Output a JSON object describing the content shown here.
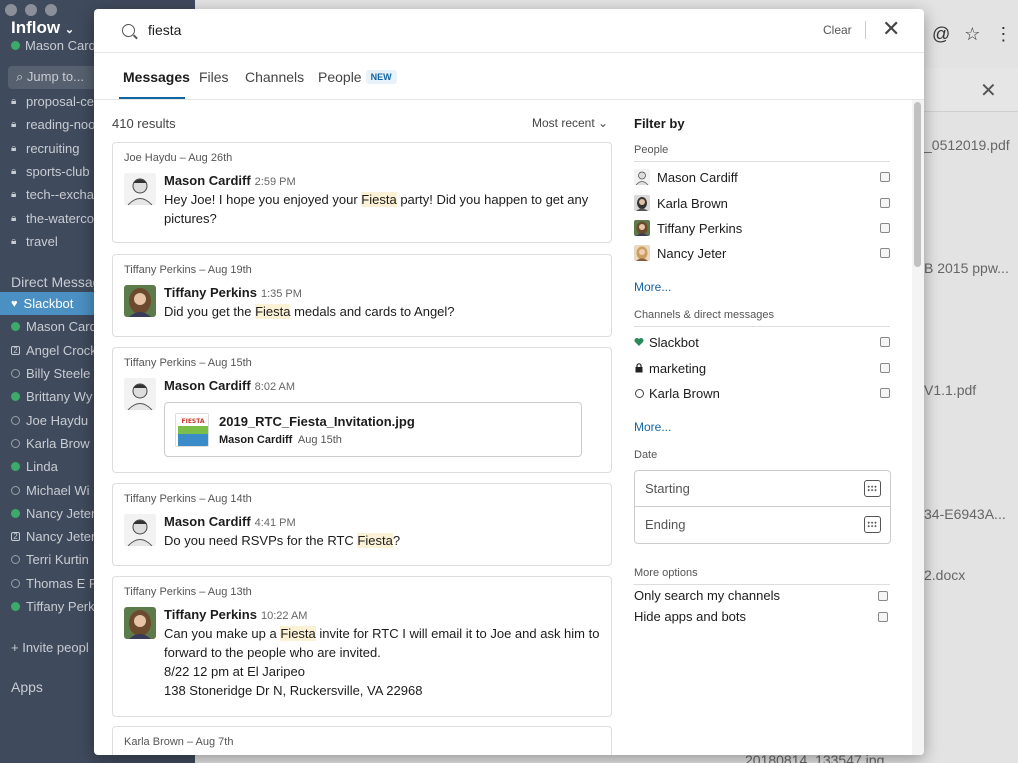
{
  "app": {
    "workspace": "Inflow",
    "user": "Mason Card",
    "jump_to": "Jump to...",
    "channels": [
      {
        "name": "proposal-ce"
      },
      {
        "name": "reading-noo"
      },
      {
        "name": "recruiting"
      },
      {
        "name": "sports-club"
      },
      {
        "name": "tech--excha"
      },
      {
        "name": "the-waterco"
      },
      {
        "name": "travel"
      }
    ],
    "direct_messages_header": "Direct Messag",
    "direct_messages": [
      {
        "name": "Slackbot",
        "status": "slackbot",
        "active": true
      },
      {
        "name": "Mason Card",
        "status": "online"
      },
      {
        "name": "Angel Crock",
        "status": "group"
      },
      {
        "name": "Billy Steele",
        "status": "offline"
      },
      {
        "name": "Brittany Wy",
        "status": "online"
      },
      {
        "name": "Joe Haydu",
        "status": "offline"
      },
      {
        "name": "Karla Brow",
        "status": "offline"
      },
      {
        "name": "Linda",
        "status": "online"
      },
      {
        "name": "Michael Wi",
        "status": "offline"
      },
      {
        "name": "Nancy Jeter",
        "status": "online"
      },
      {
        "name": "Nancy Jeter",
        "status": "group"
      },
      {
        "name": "Terri Kurtin",
        "status": "offline"
      },
      {
        "name": "Thomas E R",
        "status": "offline"
      },
      {
        "name": "Tiffany Perk",
        "status": "online"
      }
    ],
    "invite": "Invite peopl",
    "apps_header": "Apps",
    "right_files": [
      "_0512019.pdf",
      "B 2015 ppw...",
      "V1.1.pdf",
      "34-E6943A...",
      "2.docx",
      "20180814_133547.jpg"
    ]
  },
  "search": {
    "query": "fiesta",
    "clear_label": "Clear",
    "close_label": "✕"
  },
  "tabs": [
    {
      "label": "Messages",
      "active": true
    },
    {
      "label": "Files"
    },
    {
      "label": "Channels"
    },
    {
      "label": "People",
      "badge": "NEW"
    }
  ],
  "results": {
    "count": "410 results",
    "sort": "Most recent",
    "items": [
      {
        "meta": "Joe Haydu  –  Aug 26th",
        "author": "Mason Cardiff",
        "time": "2:59 PM",
        "avatar": "mason",
        "text_before": "Hey Joe! I hope you enjoyed your ",
        "highlight": "Fiesta",
        "text_after": " party! Did you happen to get any pictures?"
      },
      {
        "meta": "Tiffany Perkins  –  Aug 19th",
        "author": "Tiffany Perkins",
        "time": "1:35 PM",
        "avatar": "tiffany",
        "text_before": "Did you get the ",
        "highlight": "Fiesta",
        "text_after": " medals and cards to Angel?"
      },
      {
        "meta": "Tiffany Perkins  –  Aug 15th",
        "author": "Mason Cardiff",
        "time": "8:02 AM",
        "avatar": "mason",
        "file": {
          "name": "2019_RTC_Fiesta_Invitation.jpg",
          "by": "Mason Cardiff",
          "date": "Aug 15th",
          "thumb_text": "FIESTA"
        }
      },
      {
        "meta": "Tiffany Perkins  –  Aug 14th",
        "author": "Mason Cardiff",
        "time": "4:41 PM",
        "avatar": "mason",
        "text_before": "Do you need RSVPs for the RTC ",
        "highlight": "Fiesta",
        "text_after": "?"
      },
      {
        "meta": "Tiffany Perkins  –  Aug 13th",
        "author": "Tiffany Perkins",
        "time": "10:22 AM",
        "avatar": "tiffany",
        "text_before": "Can you make up a ",
        "highlight": "Fiesta",
        "text_after": " invite for RTC I will email it to Joe and ask him to forward to the people who are invited.",
        "extra_lines": [
          "8/22 12 pm at El Jaripeo",
          "138 Stoneridge Dr N, Ruckersville, VA 22968"
        ]
      },
      {
        "meta": "Karla Brown  –  Aug 7th"
      }
    ]
  },
  "filters": {
    "title": "Filter by",
    "people_header": "People",
    "people": [
      "Mason Cardiff",
      "Karla Brown",
      "Tiffany Perkins",
      "Nancy Jeter"
    ],
    "people_more": "More...",
    "channels_header": "Channels & direct messages",
    "channels": [
      {
        "name": "Slackbot",
        "icon": "heart"
      },
      {
        "name": "marketing",
        "icon": "lock"
      },
      {
        "name": "Karla Brown",
        "icon": "presence"
      }
    ],
    "channels_more": "More...",
    "date_header": "Date",
    "date_start": "Starting",
    "date_end": "Ending",
    "more_options_header": "More options",
    "options": [
      "Only search my channels",
      "Hide apps and bots"
    ]
  },
  "colors": {
    "accent": "#1264a3",
    "highlight": "#fbf1d4",
    "sidebar": "#3f4a5c",
    "online": "#3daa6c",
    "slackbot": "#2b8a5c"
  }
}
